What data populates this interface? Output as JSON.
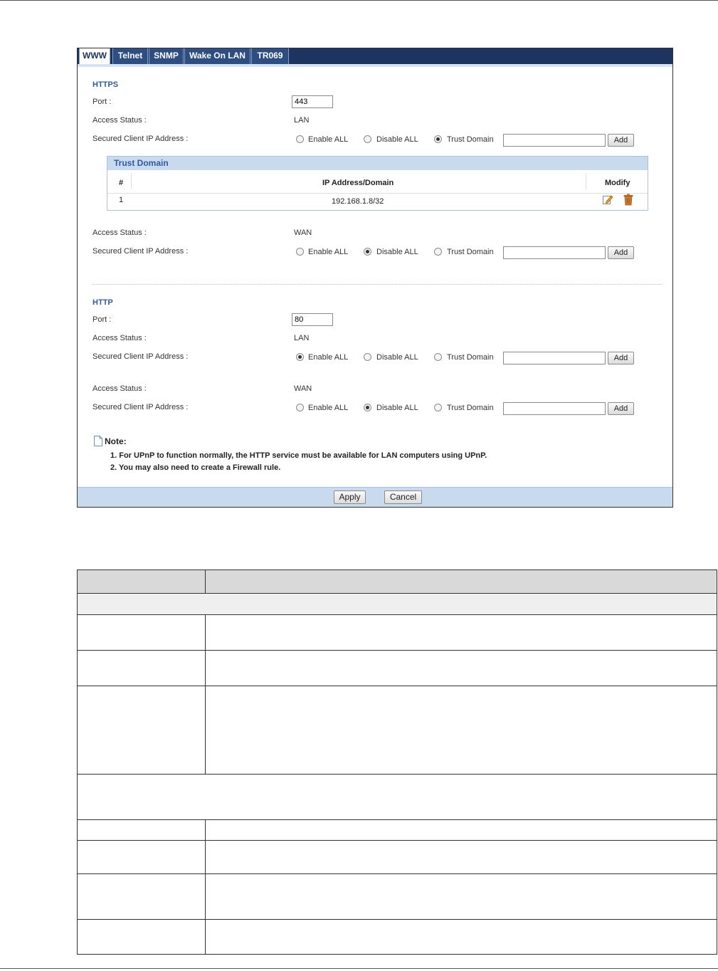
{
  "tabs": [
    {
      "label": "WWW",
      "active": true
    },
    {
      "label": "Telnet",
      "active": false
    },
    {
      "label": "SNMP",
      "active": false
    },
    {
      "label": "Wake On LAN",
      "active": false
    },
    {
      "label": "TR069",
      "active": false
    }
  ],
  "labels": {
    "port": "Port :",
    "access_status": "Access Status :",
    "secured_client": "Secured Client IP Address :",
    "enable_all": "Enable ALL",
    "disable_all": "Disable ALL",
    "trust_domain": "Trust Domain",
    "add": "Add"
  },
  "https": {
    "title": "HTTPS",
    "port": "443",
    "lan": {
      "status": "LAN",
      "selected": "trust_domain",
      "domain_value": ""
    },
    "wan": {
      "status": "WAN",
      "selected": "disable_all",
      "domain_value": ""
    }
  },
  "trust_table": {
    "title": "Trust Domain",
    "columns": [
      "#",
      "IP Address/Domain",
      "Modify"
    ],
    "rows": [
      {
        "num": "1",
        "address": "192.168.1.8/32",
        "edit_icon": "edit-icon",
        "delete_icon": "trash-icon"
      }
    ]
  },
  "http": {
    "title": "HTTP",
    "port": "80",
    "lan": {
      "status": "LAN",
      "selected": "enable_all",
      "domain_value": ""
    },
    "wan": {
      "status": "WAN",
      "selected": "disable_all",
      "domain_value": ""
    }
  },
  "note": {
    "title": "Note:",
    "icon": "note-icon",
    "lines": [
      "1. For UPnP to function normally, the HTTP service must be available for LAN computers using UPnP.",
      "2. You may also need to create a Firewall rule."
    ]
  },
  "footer": {
    "apply": "Apply",
    "cancel": "Cancel"
  },
  "colors": {
    "tabbar": "#1d3461",
    "section_title": "#2f5b9e",
    "table_header": "#c9daef",
    "edit_icon": "#e3a21a",
    "delete_icon": "#b56a1e"
  }
}
